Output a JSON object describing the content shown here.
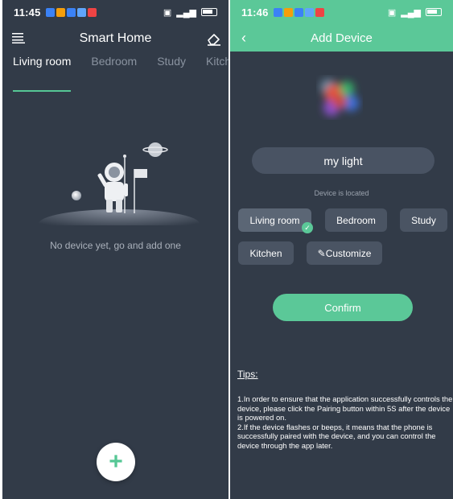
{
  "left": {
    "status": {
      "time": "11:45"
    },
    "title": "Smart Home",
    "tabs": [
      "Living room",
      "Bedroom",
      "Study",
      "Kitcher"
    ],
    "empty_text": "No device yet, go and add one",
    "fab_symbol": "+"
  },
  "right": {
    "status": {
      "time": "11:46"
    },
    "title": "Add Device",
    "device_name": "my light",
    "located_label": "Device is located",
    "rooms": [
      "Living room",
      "Bedroom",
      "Study",
      "Kitchen",
      "Customize"
    ],
    "selected_room": "Living room",
    "confirm_label": "Confirm",
    "tips_title": "Tips:",
    "tips": [
      "1.In order to ensure that the application successfully controls the device, please click the Pairing button within 5S after the device is powered on.",
      "2.If the device flashes or beeps, it means that the phone is successfully paired with the device, and you can control the device through the app later."
    ]
  },
  "colors": {
    "background": "#323b48",
    "accent": "#5bc898",
    "chip": "#4a5463"
  },
  "icons": [
    "menu-icon",
    "eraser-icon",
    "back-icon",
    "pencil-icon",
    "check-icon",
    "plus-icon"
  ]
}
